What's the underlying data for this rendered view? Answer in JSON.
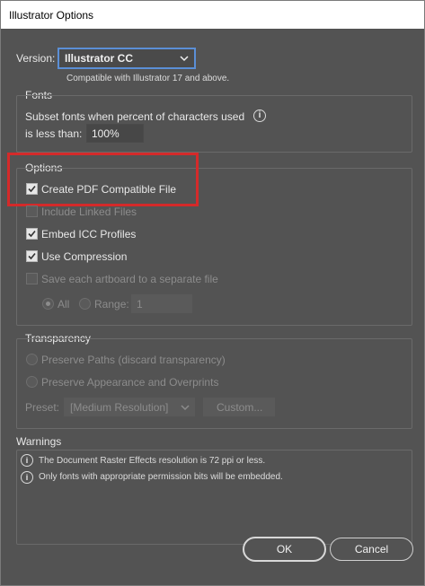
{
  "window": {
    "title": "Illustrator Options"
  },
  "version": {
    "label": "Version:",
    "selected": "Illustrator CC",
    "note": "Compatible with Illustrator 17 and above."
  },
  "fonts": {
    "title": "Fonts",
    "subset_line1": "Subset fonts when percent of characters used",
    "subset_line2": "is less than:",
    "percent": "100%"
  },
  "options": {
    "title": "Options",
    "items": [
      {
        "label": "Create PDF Compatible File",
        "checked": true,
        "enabled": true
      },
      {
        "label": "Include Linked Files",
        "checked": false,
        "enabled": false
      },
      {
        "label": "Embed ICC Profiles",
        "checked": true,
        "enabled": true
      },
      {
        "label": "Use Compression",
        "checked": true,
        "enabled": true
      },
      {
        "label": "Save each artboard to a separate file",
        "checked": false,
        "enabled": false
      }
    ],
    "all_label": "All",
    "range_label": "Range:",
    "range_value": "1"
  },
  "transparency": {
    "title": "Transparency",
    "preserve_paths": "Preserve Paths (discard transparency)",
    "preserve_appearance": "Preserve Appearance and Overprints",
    "preset_label": "Preset:",
    "preset_value": "[Medium Resolution]",
    "custom_label": "Custom..."
  },
  "warnings": {
    "title": "Warnings",
    "items": [
      "The Document Raster Effects resolution is 72 ppi or less.",
      "Only fonts with appropriate permission bits will be embedded."
    ]
  },
  "buttons": {
    "ok": "OK",
    "cancel": "Cancel"
  },
  "icons": {
    "info": "i",
    "check": "✓"
  },
  "colors": {
    "highlight": "#d42a2a",
    "background": "#535353"
  }
}
